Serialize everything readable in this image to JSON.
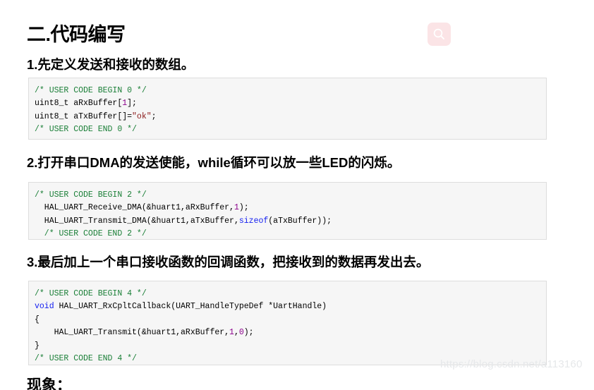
{
  "page": {
    "background": "#ffffff",
    "main_heading": "二.代码编写",
    "tail_heading": "现象："
  },
  "search_badge": {
    "icon": "search-icon",
    "background_color": "#fbe4e6",
    "icon_color": "#ffffff"
  },
  "watermark": {
    "text": "https://blog.csdn.net/a113160",
    "color": "#e6e8ea"
  },
  "steps": [
    {
      "heading": "1.先定义发送和接收的数组。",
      "code": {
        "lines": [
          [
            {
              "t": "/* USER CODE BEGIN 0 */",
              "c": "comment"
            }
          ],
          [
            {
              "t": "uint8_t aRxBuffer[",
              "c": "plain"
            },
            {
              "t": "1",
              "c": "number"
            },
            {
              "t": "];",
              "c": "plain"
            }
          ],
          [
            {
              "t": "uint8_t aTxBuffer[]=",
              "c": "plain"
            },
            {
              "t": "\"ok\"",
              "c": "string"
            },
            {
              "t": ";",
              "c": "plain"
            }
          ],
          [
            {
              "t": "/* USER CODE END 0 */",
              "c": "comment"
            }
          ]
        ]
      }
    },
    {
      "heading": "2.打开串口DMA的发送使能，while循环可以放一些LED的闪烁。",
      "code": {
        "lines": [
          [
            {
              "t": "/* USER CODE BEGIN 2 */",
              "c": "comment"
            }
          ],
          [
            {
              "t": "  HAL_UART_Receive_DMA(&huart1,aRxBuffer,",
              "c": "plain"
            },
            {
              "t": "1",
              "c": "number"
            },
            {
              "t": ");",
              "c": "plain"
            }
          ],
          [
            {
              "t": "  HAL_UART_Transmit_DMA(&huart1,aTxBuffer,",
              "c": "plain"
            },
            {
              "t": "sizeof",
              "c": "keyword"
            },
            {
              "t": "(aTxBuffer));",
              "c": "plain"
            }
          ],
          [
            {
              "t": "  /* USER CODE END 2 */",
              "c": "comment"
            }
          ]
        ]
      }
    },
    {
      "heading": "3.最后加上一个串口接收函数的回调函数，把接收到的数据再发出去。",
      "code": {
        "lines": [
          [
            {
              "t": "/* USER CODE BEGIN 4 */",
              "c": "comment"
            }
          ],
          [
            {
              "t": "void",
              "c": "keyword"
            },
            {
              "t": " HAL_UART_RxCpltCallback(UART_HandleTypeDef *UartHandle)",
              "c": "plain"
            }
          ],
          [
            {
              "t": "{",
              "c": "plain"
            }
          ],
          [
            {
              "t": "    HAL_UART_Transmit(&huart1,aRxBuffer,",
              "c": "plain"
            },
            {
              "t": "1",
              "c": "number"
            },
            {
              "t": ",",
              "c": "plain"
            },
            {
              "t": "0",
              "c": "number"
            },
            {
              "t": ");",
              "c": "plain"
            }
          ],
          [
            {
              "t": "}",
              "c": "plain"
            }
          ],
          [
            {
              "t": "/* USER CODE END 4 */",
              "c": "comment"
            }
          ]
        ]
      }
    }
  ],
  "syntax_colors": {
    "comment": "#1a7f37",
    "keyword": "#1520f0",
    "string": "#8b1a1a",
    "number": "#8b008b",
    "plain": "#000000",
    "code_background": "#f6f6f6",
    "code_border": "#dddddd"
  }
}
